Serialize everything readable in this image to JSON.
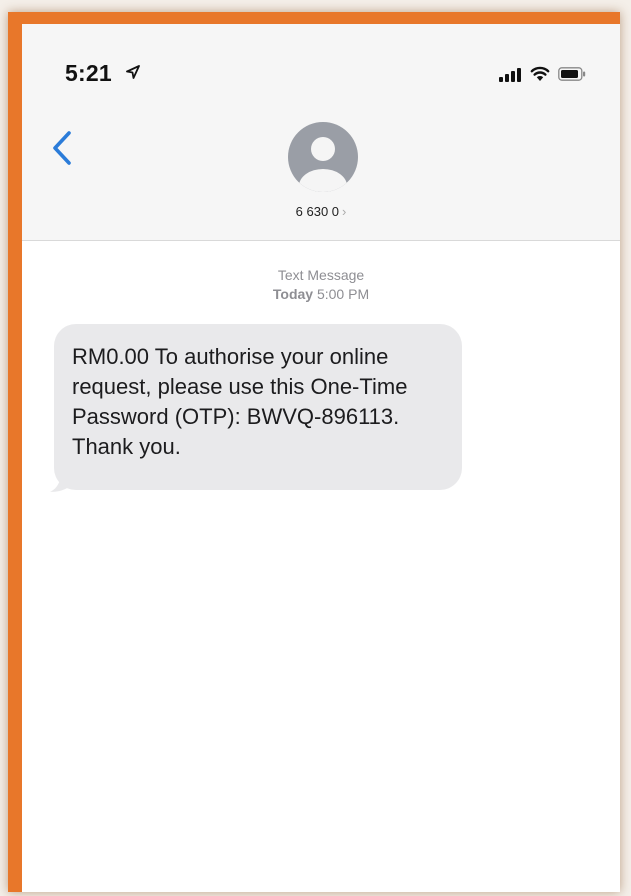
{
  "status_bar": {
    "time": "5:21",
    "icons": [
      "location-arrow-icon",
      "signal-bars-icon",
      "wifi-icon",
      "battery-icon"
    ]
  },
  "nav": {
    "back_icon": "chevron-left-icon",
    "avatar_icon": "person-avatar-icon",
    "contact_name": "6 630 0",
    "contact_chevron": "›"
  },
  "conversation": {
    "service_label": "Text Message",
    "date_label": "Today",
    "time_label": "5:00 PM",
    "messages": [
      {
        "direction": "incoming",
        "text": "RM0.00 To authorise your online request, please use this One-Time Password (OTP): BWVQ-896113. Thank you."
      }
    ]
  },
  "colors": {
    "frame_border": "#e8772a",
    "accent_blue": "#2b7cd9",
    "bubble_gray": "#e9e9eb"
  }
}
